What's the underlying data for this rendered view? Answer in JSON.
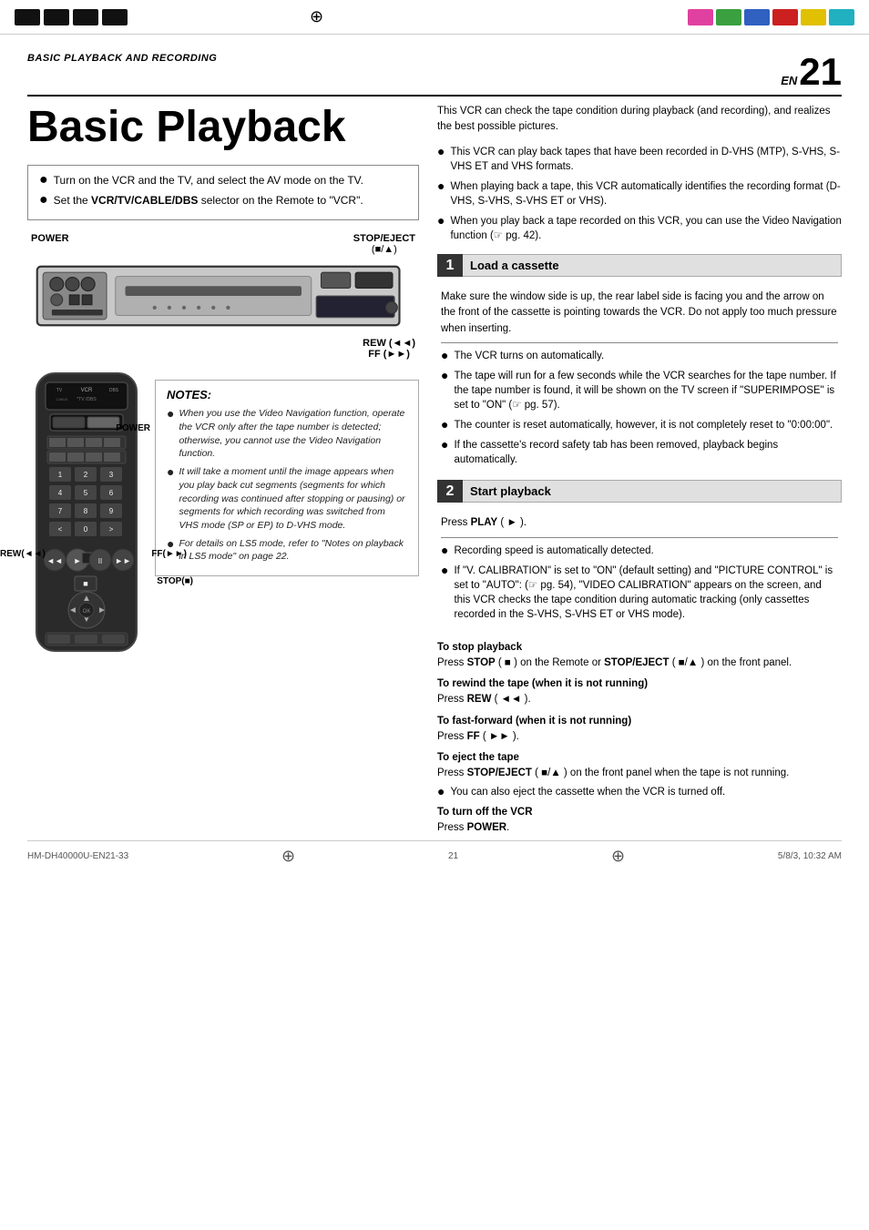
{
  "topBar": {
    "colorBlocks": [
      "magenta",
      "green",
      "blue",
      "red",
      "yellow",
      "cyan"
    ],
    "blackBlocks": 4
  },
  "header": {
    "sectionTitle": "BASIC PLAYBACK AND RECORDING",
    "enLabel": "EN",
    "pageNumber": "21"
  },
  "leftColumn": {
    "bigTitle": "Basic Playback",
    "setupBullets": [
      {
        "text": "Turn on the VCR and the TV, and select the AV mode on the TV."
      },
      {
        "text": "Set the ",
        "boldText": "VCR/TV/CABLE/DBS",
        "textAfter": " selector on the Remote to \"VCR\"."
      }
    ],
    "vcrLabels": {
      "power": "POWER",
      "stopEject": "STOP/EJECT",
      "stopEjectSub": "(■/▲)",
      "rew": "REW (◄◄)",
      "ff": "FF (►►)"
    },
    "remoteLabels": {
      "power": "POWER",
      "rew": "REW(◄◄)",
      "ff": "FF(►►)",
      "stop": "STOP(■)"
    },
    "notes": {
      "title": "NOTES:",
      "items": [
        "When you use the Video Navigation function, operate the VCR only after the tape number is detected; otherwise, you cannot use the Video Navigation function.",
        "It will take a moment until the image appears when you play back cut segments (segments for which recording was continued after stopping or pausing) or segments for which recording was switched from VHS mode (SP or EP) to D-VHS mode.",
        "For details on LS5 mode, refer to \"Notes on playback in LS5 mode\" on page 22."
      ]
    }
  },
  "rightColumn": {
    "intro": "This VCR can check the tape condition during playback (and recording), and realizes the best possible pictures.",
    "introBullets": [
      "This VCR can play back tapes that have been recorded in D-VHS (MTP), S-VHS, S-VHS ET and VHS formats.",
      "When playing back a tape, this VCR automatically identifies the recording format (D-VHS, S-VHS, S-VHS ET or VHS).",
      "When you play back a tape recorded on this VCR, you can use the Video Navigation function (☞ pg. 42)."
    ],
    "sections": [
      {
        "number": "1",
        "title": "Load a cassette",
        "intro": "Make sure the window side is up, the rear label side is facing you and the arrow on the front of the cassette is pointing towards the VCR. Do not apply too much pressure when inserting.",
        "bullets": [
          "The VCR turns on automatically.",
          "The tape will run for a few seconds while the VCR searches for the tape number. If the tape number is found, it will be shown on the TV screen if \"SUPERIMPOSE\" is set to \"ON\" (☞ pg. 57).",
          "The counter is reset automatically, however, it is not completely reset to \"0:00:00\".",
          "If the cassette's record safety tab has been removed, playback begins automatically."
        ]
      },
      {
        "number": "2",
        "title": "Start playback",
        "intro": "Press PLAY ( ► ).",
        "bullets": [
          "Recording speed is automatically detected.",
          "If \"V. CALIBRATION\" is set to \"ON\" (default setting) and \"PICTURE CONTROL\" is set to \"AUTO\": (☞ pg. 54), \"VIDEO CALIBRATION\" appears on the screen, and this VCR checks the tape condition during automatic tracking (only cassettes recorded in the S-VHS, S-VHS ET or VHS mode)."
        ]
      }
    ],
    "subsections": [
      {
        "title": "To stop playback",
        "content": "Press STOP ( ■ ) on the Remote or STOP/EJECT ( ■/▲ ) on the front panel."
      },
      {
        "title": "To rewind the tape (when it is not running)",
        "content": "Press REW ( ◄◄ )."
      },
      {
        "title": "To fast-forward (when it is not running)",
        "content": "Press FF ( ►► )."
      },
      {
        "title": "To eject the tape",
        "content": "Press STOP/EJECT ( ■/▲ ) on the front panel when the tape is not running.",
        "extra": "You can also eject the cassette when the VCR is turned off."
      },
      {
        "title": "To turn off the VCR",
        "content": "Press POWER."
      }
    ]
  },
  "footer": {
    "leftText": "HM-DH40000U-EN21-33",
    "centerText": "21",
    "rightText": "5/8/3, 10:32 AM"
  }
}
